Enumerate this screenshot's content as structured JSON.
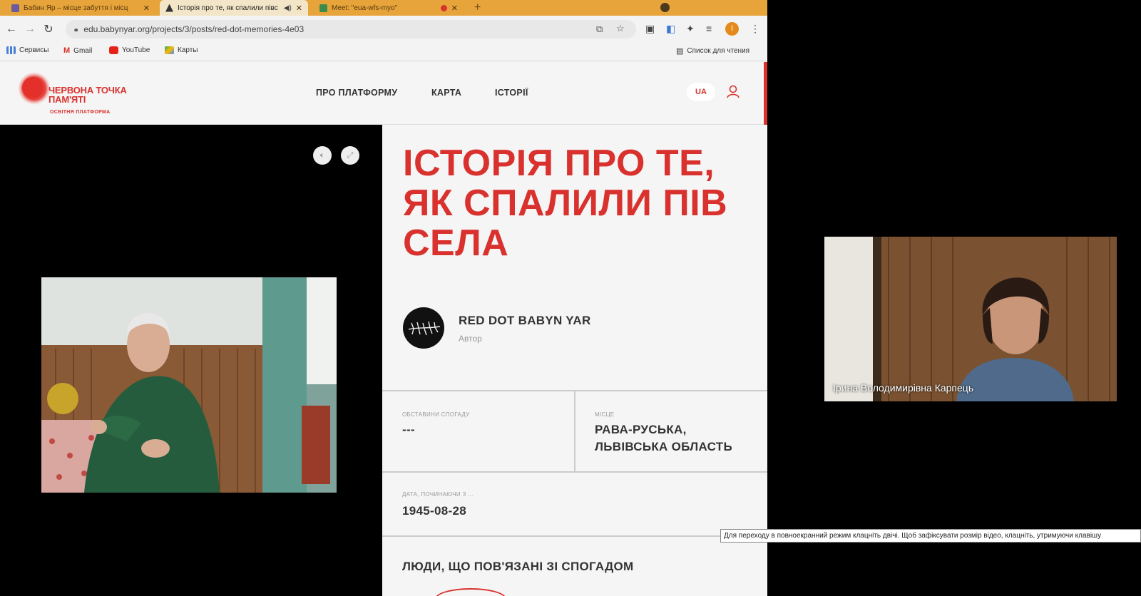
{
  "tabs": [
    {
      "label": "Бабин Яр – місце забуття і місц",
      "active": false
    },
    {
      "label": "Історія про те, як спалили півс",
      "active": true
    },
    {
      "label": "Meet: \"eua-wfs-myo\"",
      "active": false
    }
  ],
  "toolbar": {
    "url": "edu.babynyar.org/projects/3/posts/red-dot-memories-4e03",
    "profile_initial": "I"
  },
  "bookmarks": {
    "items": [
      "Сервисы",
      "Gmail",
      "YouTube",
      "Карты"
    ],
    "reading_list": "Список для чтения"
  },
  "site": {
    "logo_line1": "ЧЕРВОНА ТОЧКА",
    "logo_line2": "ПАМ'ЯТІ",
    "logo_sub": "ОСВІТНЯ ПЛАТФОРМА",
    "nav": [
      "ПРО ПЛАТФОРМУ",
      "КАРТА",
      "ІСТОРІЇ"
    ],
    "lang": "UA"
  },
  "story": {
    "title": "ІСТОРІЯ ПРО ТЕ, ЯК СПАЛИЛИ ПІВ СЕЛА",
    "author_name": "RED DOT BABYN YAR",
    "author_role": "Автор",
    "circumstances_label": "ОБСТАВИНИ СПОГАДУ",
    "circumstances_value": "---",
    "place_label": "МІСЦЕ",
    "place_line1": "РАВА-РУСЬКА,",
    "place_line2": "ЛЬВІВСЬКА ОБЛАСТЬ",
    "date_label": "ДАТА, ПОЧИНАЮЧИ З ...",
    "date_value": "1945-08-28",
    "people_heading": "ЛЮДИ, ЩО ПОВ'ЯЗАНІ ЗІ СПОГАДОМ"
  },
  "participant": {
    "name": "Ірина Володимирівна Карпець"
  },
  "tooltip": "Для переходу в повноекранний режим клацніть двічі. Щоб зафіксувати розмір відео, клацніть, утримуючи клавішу"
}
